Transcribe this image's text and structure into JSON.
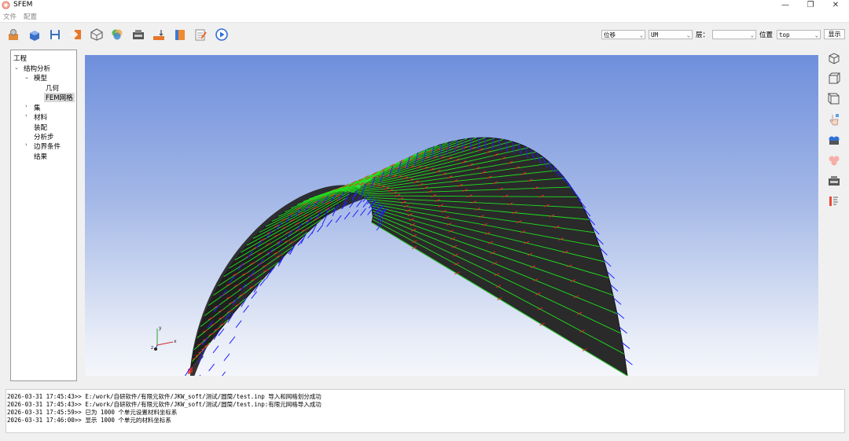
{
  "window": {
    "title": "SFEM",
    "minimize": "—",
    "restore": "❐",
    "close": "✕"
  },
  "menu": [
    "文件",
    "配置"
  ],
  "toolbar": {
    "display_type": "位移",
    "component": "UM",
    "layer_label": "层：",
    "layer_value": "",
    "position_label": "位置",
    "position_value": "top",
    "show_button": "显示"
  },
  "tree": {
    "root": "工程",
    "analysis": "结构分析",
    "model": "模型",
    "geometry": "几何",
    "fem_mesh": "FEM网格",
    "set": "集",
    "material": "材料",
    "assembly": "装配",
    "step": "分析步",
    "boundary": "边界条件",
    "result": "结果"
  },
  "axes": {
    "x": "x",
    "y": "y",
    "z": "z"
  },
  "console": [
    "2026-03-31 17:45:43>> E:/work/自研软件/有限元软件/JKW_soft/测试/圆筒/test.inp 导入和网格划分成功",
    "2026-03-31 17:45:43>> E:/work/自研软件/有限元软件/JKW_soft/测试/圆筒/test.inp:有限元网格导入成功",
    "2026-03-31 17:45:59>> 已为 1000 个单元设置材料坐标系",
    "2026-03-31 17:46:00>> 显示 1000 个单元的材料坐标系"
  ],
  "colors": {
    "mesh_edge_x": "#ff2020",
    "mesh_edge_y": "#20e020",
    "normal": "#2020ff",
    "shell": "#2a2a2a"
  }
}
